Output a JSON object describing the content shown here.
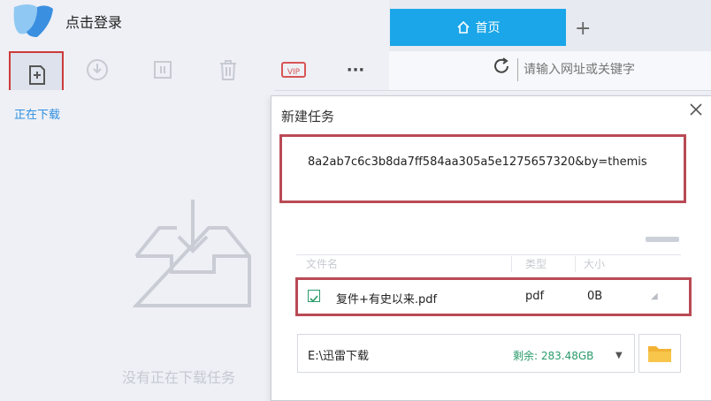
{
  "app": {
    "login_label": "点击登录",
    "active_tab_label": "正在下载",
    "empty_message": "没有正在下载任务"
  },
  "browser": {
    "home_tab_label": "首页",
    "new_tab_label": "+",
    "url_placeholder": "请输入网址或关键字"
  },
  "toolbar": {
    "buttons": [
      "new-task",
      "start",
      "pause",
      "delete",
      "vip",
      "more"
    ],
    "more_label": "···",
    "vip_label": "VIP"
  },
  "dialog": {
    "title": "新建任务",
    "close_label": "×",
    "link_value": "8a2ab7c6c3b8da7ff584aa305a5e1275657320&by=themis",
    "columns": [
      "文件名",
      "类型",
      "大小"
    ],
    "file": {
      "checked": true,
      "name": "复件+有史以来.pdf",
      "type": "pdf",
      "size": "0B"
    },
    "save_path": "E:\\迅雷下载",
    "free_space": "剩余: 283.48GB"
  },
  "colors": {
    "accent": "#1aa6e8",
    "highlight_box": "#b94a55",
    "success": "#2a9b6b"
  }
}
